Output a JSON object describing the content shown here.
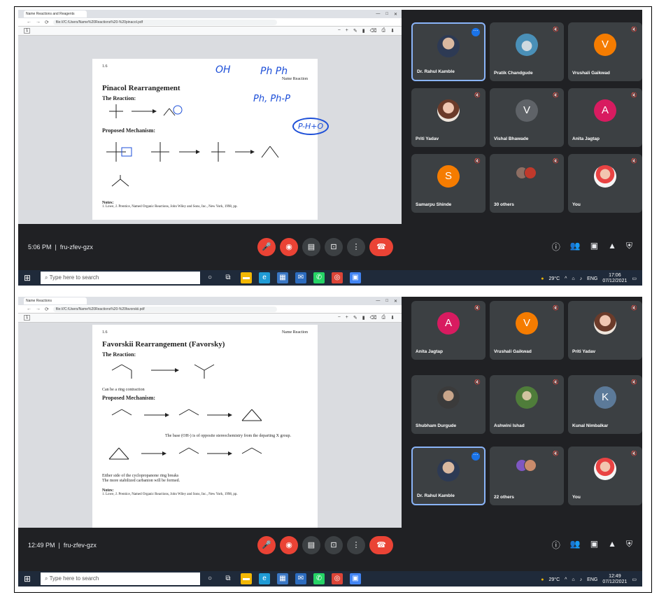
{
  "screenshot1": {
    "tab_title": "Name Reactions and Reagents",
    "address": "file:///C:/Users/Name%20Reactions%20-%20pinacol.pdf",
    "page_number": "1",
    "doc": {
      "page_label": "1.6",
      "running_head": "Name Reaction",
      "title": "Pinacol Rearrangement",
      "sub1": "The Reaction:",
      "sub2": "Proposed Mechanism:",
      "notes_head": "Notes:",
      "notes_text": "1. Lowe, J. Prentice, Named Organic Reactions, John Wiley and Sons, Inc., New York, 1998, pp."
    },
    "handwriting": [
      "OH",
      "Ph Ph",
      "Ph, Ph-P",
      "P-H+O"
    ],
    "participants": [
      {
        "name": "Dr. Rahul Kamble",
        "initial": "",
        "style": "av-photo",
        "active": true,
        "more": true
      },
      {
        "name": "Pratik Chandgude",
        "initial": "",
        "style": "av-sky",
        "active": false
      },
      {
        "name": "Vrushali Gaikwad",
        "initial": "V",
        "style": "orange",
        "active": false
      },
      {
        "name": "Priti Yadav",
        "initial": "",
        "style": "av-photo2",
        "active": false
      },
      {
        "name": "Vishal Bhawade",
        "initial": "V",
        "style": "slate",
        "active": false
      },
      {
        "name": "Anita Jagtap",
        "initial": "A",
        "style": "pink",
        "active": false
      },
      {
        "name": "Samarpu Shinde",
        "initial": "S",
        "style": "orange",
        "active": false
      },
      {
        "name": "30 others",
        "initial": "",
        "style": "others",
        "active": false
      },
      {
        "name": "You",
        "initial": "",
        "style": "av-you",
        "active": false
      }
    ],
    "time": "5:06 PM",
    "meeting_code": "fru-zfev-gzx",
    "taskbar": {
      "search_placeholder": "Type here to search",
      "weather": "29°C",
      "lang": "ENG",
      "clock_time": "17:06",
      "clock_date": "07/12/2021"
    }
  },
  "screenshot2": {
    "tab_title": "Name Reactions",
    "address": "file:///C:/Users/Name%20Reactions%20-%20favorskii.pdf",
    "page_number": "1",
    "doc": {
      "page_label": "1.6",
      "running_head": "Name Reaction",
      "title": "Favorskii Rearrangement (Favorsky)",
      "sub1": "The Reaction:",
      "sub2": "Proposed Mechanism:",
      "caption1": "Can be a ring contraction",
      "caption2": "The base (OH-) is of opposite stereochemistry from the departing X group.",
      "caption3": "Either side of the cyclopropanone ring breaks",
      "caption4": "The more stabilized carbanion will be formed.",
      "notes_head": "Notes:",
      "notes_text": "1. Lowe, J. Prentice, Named Organic Reactions, John Wiley and Sons, Inc., New York, 1998, pp."
    },
    "participants": [
      {
        "name": "Anita Jagtap",
        "initial": "A",
        "style": "pink",
        "active": false
      },
      {
        "name": "Vrushali Gaikwad",
        "initial": "V",
        "style": "orange",
        "active": false
      },
      {
        "name": "Priti Yadav",
        "initial": "",
        "style": "av-photo2",
        "active": false
      },
      {
        "name": "Shubham Durgude",
        "initial": "",
        "style": "av-photo3",
        "active": false
      },
      {
        "name": "Ashwini Ishad",
        "initial": "",
        "style": "av-photo4",
        "active": false
      },
      {
        "name": "Kunal Nimbalkar",
        "initial": "K",
        "style": "steel",
        "active": false
      },
      {
        "name": "Dr. Rahul Kamble",
        "initial": "",
        "style": "av-photo",
        "active": true,
        "more": true
      },
      {
        "name": "22 others",
        "initial": "",
        "style": "others2",
        "active": false
      },
      {
        "name": "You",
        "initial": "",
        "style": "av-you",
        "active": false
      }
    ],
    "time": "12:49 PM",
    "meeting_code": "fru-zfev-gzx",
    "taskbar": {
      "search_placeholder": "Type here to search",
      "weather": "29°C",
      "lang": "ENG",
      "clock_time": "12:49",
      "clock_date": "07/12/2021"
    }
  },
  "colors": {
    "meet_bg": "#202124",
    "tile": "#3c4043",
    "end_call": "#ea4335",
    "active_border": "#8ab4f8",
    "orange": "#f57c00",
    "pink": "#d81b60",
    "slate": "#5f6368",
    "steel": "#5c7a99"
  }
}
